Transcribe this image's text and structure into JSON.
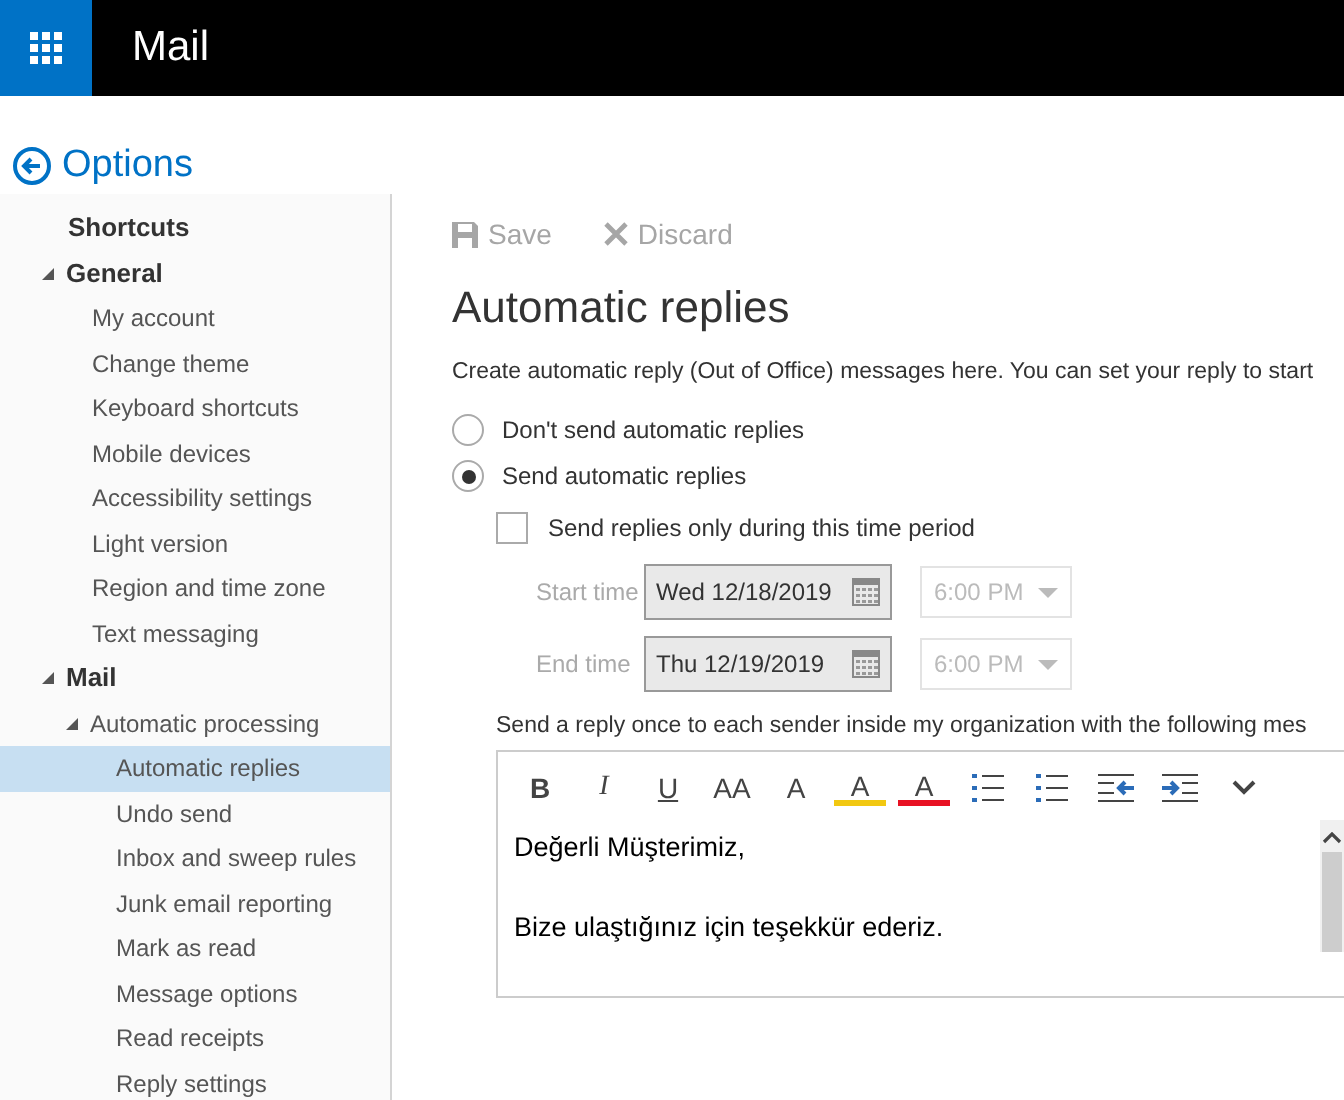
{
  "header": {
    "app_title": "Mail"
  },
  "options_title": "Options",
  "sidebar": {
    "items": [
      {
        "label": "Shortcuts",
        "selected": false
      },
      {
        "label": "General",
        "expanded": true,
        "selected": false,
        "children": [
          {
            "label": "My account",
            "selected": false
          },
          {
            "label": "Change theme",
            "selected": false
          },
          {
            "label": "Keyboard shortcuts",
            "selected": false
          },
          {
            "label": "Mobile devices",
            "selected": false
          },
          {
            "label": "Accessibility settings",
            "selected": false
          },
          {
            "label": "Light version",
            "selected": false
          },
          {
            "label": "Region and time zone",
            "selected": false
          },
          {
            "label": "Text messaging",
            "selected": false
          }
        ]
      },
      {
        "label": "Mail",
        "expanded": true,
        "selected": false,
        "children": [
          {
            "label": "Automatic processing",
            "expanded": true,
            "selected": false,
            "children": [
              {
                "label": "Automatic replies",
                "selected": true
              },
              {
                "label": "Undo send",
                "selected": false
              },
              {
                "label": "Inbox and sweep rules",
                "selected": false
              },
              {
                "label": "Junk email reporting",
                "selected": false
              },
              {
                "label": "Mark as read",
                "selected": false
              },
              {
                "label": "Message options",
                "selected": false
              },
              {
                "label": "Read receipts",
                "selected": false
              },
              {
                "label": "Reply settings",
                "selected": false
              }
            ]
          }
        ]
      }
    ]
  },
  "command_bar": [
    {
      "kind": "save",
      "label": "Save"
    },
    {
      "kind": "discard",
      "label": "Discard"
    }
  ],
  "page_title": "Automatic replies",
  "description": "Create automatic reply (Out of Office) messages here. You can set your reply to start",
  "reply_options": [
    {
      "label": "Don't send automatic replies",
      "selected": false
    },
    {
      "label": "Send automatic replies",
      "selected": true
    }
  ],
  "time_period": {
    "label": "Send replies only during this time period",
    "checked": false
  },
  "time_rows": [
    {
      "label": "Start time",
      "date": "Wed 12/18/2019",
      "time": "6:00 PM",
      "disabled": true
    },
    {
      "label": "End time",
      "date": "Thu 12/19/2019",
      "time": "6:00 PM",
      "disabled": true
    }
  ],
  "inside_label": "Send a reply once to each sender inside my organization with the following mes",
  "editor_toolbar": [
    {
      "kind": "bold",
      "label": "B"
    },
    {
      "kind": "italic",
      "label": "I"
    },
    {
      "kind": "underline",
      "label": "U"
    },
    {
      "kind": "font-size",
      "label": "AA"
    },
    {
      "kind": "grow",
      "label": "A"
    },
    {
      "kind": "highlight",
      "label": "A"
    },
    {
      "kind": "font-color",
      "label": "A"
    },
    {
      "kind": "bullets"
    },
    {
      "kind": "numbering"
    },
    {
      "kind": "outdent"
    },
    {
      "kind": "indent"
    },
    {
      "kind": "more"
    }
  ],
  "editor_lines": [
    "Değerli Müşterimiz,",
    "Bize ulaştığınız için teşekkür ederiz."
  ]
}
